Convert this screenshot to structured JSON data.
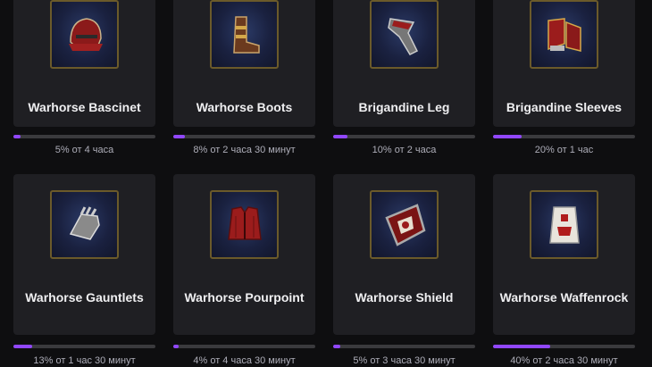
{
  "accent_color": "#9147ff",
  "rewards": [
    {
      "name": "Warhorse Bascinet",
      "icon": "helmet-icon",
      "progress_text": "5% от 4 часа",
      "progress": 0.05
    },
    {
      "name": "Warhorse Boots",
      "icon": "boots-icon",
      "progress_text": "8% от 2 часа 30 минут",
      "progress": 0.08
    },
    {
      "name": "Brigandine Leg",
      "icon": "leg-armor-icon",
      "progress_text": "10% от 2 часа",
      "progress": 0.1
    },
    {
      "name": "Brigandine Sleeves",
      "icon": "sleeves-icon",
      "progress_text": "20% от 1 час",
      "progress": 0.2
    },
    {
      "name": "Warhorse Gauntlets",
      "icon": "gauntlets-icon",
      "progress_text": "13% от 1 час 30 минут",
      "progress": 0.13
    },
    {
      "name": "Warhorse Pourpoint",
      "icon": "pourpoint-icon",
      "progress_text": "4% от 4 часа 30 минут",
      "progress": 0.04
    },
    {
      "name": "Warhorse Shield",
      "icon": "shield-icon",
      "progress_text": "5% от 3 часа 30 минут",
      "progress": 0.05
    },
    {
      "name": "Warhorse Waffenrock",
      "icon": "waffenrock-icon",
      "progress_text": "40% от 2 часа 30 минут",
      "progress": 0.4
    }
  ]
}
